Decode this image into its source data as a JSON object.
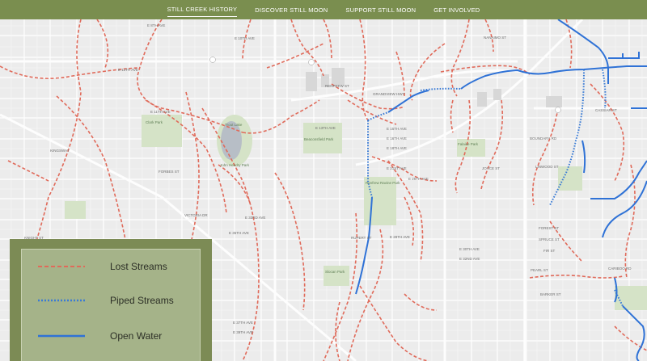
{
  "nav": {
    "items": [
      "STILL CREEK HISTORY",
      "DISCOVER STILL MOON",
      "SUPPORT STILL MOON",
      "GET INVOLVED"
    ],
    "active": "STILL CREEK HISTORY"
  },
  "legend": {
    "lost_label": "Lost Streams",
    "piped_label": "Piped Streams",
    "open_label": "Open Water"
  },
  "colors": {
    "nav_bg": "#7a8e4f",
    "lost_streams": "#e06a5a",
    "piped_streams": "#3a7bd5",
    "open_water": "#2f72d6",
    "legend_outer": "#7c8b55",
    "legend_inner": "#a5b389"
  },
  "map_labels": {
    "e8th": "E 8TH AVE",
    "e10th": "E 10TH AVE",
    "e12th": "E 12TH AVE",
    "e11th": "E 11TH AVE",
    "e13th": "E 13TH AVE",
    "e15th": "E 15TH AVE",
    "e16th": "E 16TH AVE",
    "e18th": "E 18TH AVE",
    "e28th": "E 28TH AVE",
    "e32nd": "E 32ND AVE",
    "e35th": "E 35TH AVE",
    "e37th": "E 37TH AVE",
    "e39th": "E 39TH AVE",
    "e21st": "E 21ST AVE",
    "e26th": "E 26TH AVE",
    "e33rd": "E 33RD AVE",
    "e30th": "E 30TH AVE",
    "park1": "Clark Park",
    "park2": "Trout Lake",
    "park3": "John Hendry Park",
    "park4": "Beaconsfield Park",
    "park5": "Falaise Park",
    "park6": "Renfrew Ravine Park",
    "park7": "Slocan Park",
    "forbes": "FORBES ST",
    "rupert": "RUPERT ST",
    "renfrew": "RENFREW ST",
    "joyce": "JOYCE ST",
    "boundary": "BOUNDARY RD",
    "grandview": "GRANDVIEW HWY",
    "kingsway": "KINGSWAY",
    "nanaimo": "NANAIMO ST",
    "knight": "KNIGHT ST",
    "victoria": "VICTORIA DR",
    "cassiar": "CASSIAR ST",
    "spruce": "SPRUCE ST",
    "fir": "FIR ST",
    "forest": "FOREST ST",
    "barker": "BARKER ST",
    "pearl": "PEARL ST",
    "linwood": "LINWOOD ST",
    "cariboo": "CARIBOO RD"
  }
}
